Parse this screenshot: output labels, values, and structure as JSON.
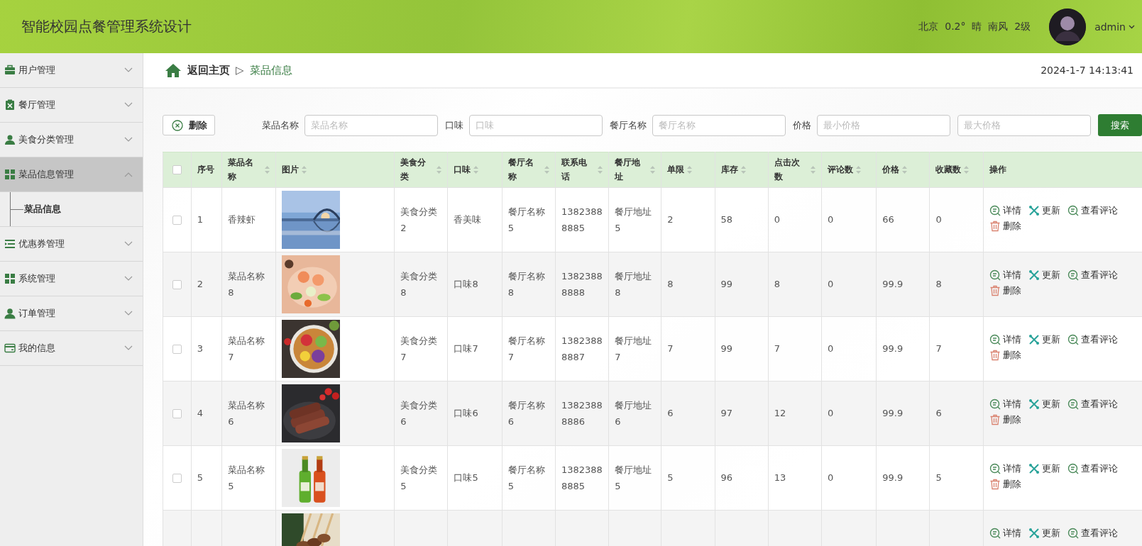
{
  "header": {
    "title": "智能校园点餐管理系统设计",
    "weather": "北京  0.2°  晴  南风  2级",
    "user": "admin"
  },
  "sidebar": {
    "items": [
      {
        "label": "用户管理",
        "expanded": false
      },
      {
        "label": "餐厅管理",
        "expanded": false
      },
      {
        "label": "美食分类管理",
        "expanded": false
      },
      {
        "label": "菜品信息管理",
        "expanded": true,
        "children": [
          {
            "label": "菜品信息",
            "selected": true
          }
        ]
      },
      {
        "label": "优惠券管理",
        "expanded": false
      },
      {
        "label": "系统管理",
        "expanded": false
      },
      {
        "label": "订单管理",
        "expanded": false
      },
      {
        "label": "我的信息",
        "expanded": false
      }
    ]
  },
  "breadcrumb": {
    "home": "返回主页",
    "separator": "▷",
    "current": "菜品信息",
    "datetime": "2024-1-7 14:13:41"
  },
  "toolbar": {
    "delete_button": "删除",
    "filters": [
      {
        "label": "菜品名称",
        "placeholder": "菜品名称"
      },
      {
        "label": "口味",
        "placeholder": "口味"
      },
      {
        "label": "餐厅名称",
        "placeholder": "餐厅名称"
      },
      {
        "label": "价格",
        "placeholder": "最小价格"
      },
      {
        "placeholder": "最大价格"
      }
    ],
    "search_button": "搜索"
  },
  "table": {
    "select_all": {
      "checked": false
    },
    "columns": [
      {
        "label": "序号",
        "sortable": false
      },
      {
        "label": "菜品名称",
        "sortable": true
      },
      {
        "label": "图片",
        "sortable": true
      },
      {
        "label": "美食分类",
        "sortable": true
      },
      {
        "label": "口味",
        "sortable": true
      },
      {
        "label": "餐厅名称",
        "sortable": true
      },
      {
        "label": "联系电话",
        "sortable": true
      },
      {
        "label": "餐厅地址",
        "sortable": true
      },
      {
        "label": "单限",
        "sortable": true
      },
      {
        "label": "库存",
        "sortable": true
      },
      {
        "label": "点击次数",
        "sortable": true
      },
      {
        "label": "评论数",
        "sortable": true
      },
      {
        "label": "价格",
        "sortable": true
      },
      {
        "label": "收藏数",
        "sortable": true
      },
      {
        "label": "操作",
        "sortable": false
      }
    ],
    "rows": [
      {
        "checked": false,
        "cells": [
          "1",
          "香辣虾",
          "美食分类2",
          "香美味",
          "餐厅名称5",
          "13823888885",
          "餐厅地址5",
          "2",
          "58",
          "0",
          "0",
          "66",
          "0"
        ],
        "actions": [
          {
            "kind": "detail",
            "label": "详情"
          },
          {
            "kind": "update",
            "label": "更新"
          },
          {
            "kind": "comments",
            "label": "查看评论"
          },
          {
            "kind": "delete",
            "label": "删除"
          }
        ]
      },
      {
        "checked": false,
        "cells": [
          "2",
          "菜品名称8",
          "美食分类8",
          "口味8",
          "餐厅名称8",
          "13823888888",
          "餐厅地址8",
          "8",
          "99",
          "8",
          "0",
          "99.9",
          "8"
        ],
        "actions": [
          {
            "kind": "detail",
            "label": "详情"
          },
          {
            "kind": "update",
            "label": "更新"
          },
          {
            "kind": "comments",
            "label": "查看评论"
          },
          {
            "kind": "delete",
            "label": "删除"
          }
        ]
      },
      {
        "checked": false,
        "cells": [
          "3",
          "菜品名称7",
          "美食分类7",
          "口味7",
          "餐厅名称7",
          "13823888887",
          "餐厅地址7",
          "7",
          "99",
          "7",
          "0",
          "99.9",
          "7"
        ],
        "actions": [
          {
            "kind": "detail",
            "label": "详情"
          },
          {
            "kind": "update",
            "label": "更新"
          },
          {
            "kind": "comments",
            "label": "查看评论"
          },
          {
            "kind": "delete",
            "label": "删除"
          }
        ]
      },
      {
        "checked": false,
        "cells": [
          "4",
          "菜品名称6",
          "美食分类6",
          "口味6",
          "餐厅名称6",
          "13823888886",
          "餐厅地址6",
          "6",
          "97",
          "12",
          "0",
          "99.9",
          "6"
        ],
        "actions": [
          {
            "kind": "detail",
            "label": "详情"
          },
          {
            "kind": "update",
            "label": "更新"
          },
          {
            "kind": "comments",
            "label": "查看评论"
          },
          {
            "kind": "delete",
            "label": "删除"
          }
        ]
      },
      {
        "checked": false,
        "cells": [
          "5",
          "菜品名称5",
          "美食分类5",
          "口味5",
          "餐厅名称5",
          "13823888885",
          "餐厅地址5",
          "5",
          "96",
          "13",
          "0",
          "99.9",
          "5"
        ],
        "actions": [
          {
            "kind": "detail",
            "label": "详情"
          },
          {
            "kind": "update",
            "label": "更新"
          },
          {
            "kind": "comments",
            "label": "查看评论"
          },
          {
            "kind": "delete",
            "label": "删除"
          }
        ]
      },
      {
        "actions": [
          {
            "kind": "detail",
            "label": "详情"
          },
          {
            "kind": "update",
            "label": "更新"
          },
          {
            "kind": "comments",
            "label": "查看评论"
          }
        ]
      }
    ]
  }
}
